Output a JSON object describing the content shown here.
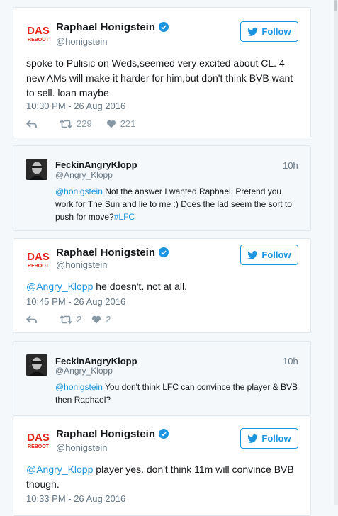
{
  "tweet1": {
    "name": "Raphael Honigstein",
    "handle": "@honigstein",
    "follow_label": "Follow",
    "text": "spoke to Pulisic on Weds,seemed very excited about CL. 4 new AMs will make it harder for him,but don't think BVB want to sell. loan maybe",
    "timestamp": "10:30 PM - 26 Aug 2016",
    "retweets": "229",
    "likes": "221"
  },
  "reply1": {
    "name": "FeckinAngryKlopp",
    "handle": "@Angry_Klopp",
    "time": "10h",
    "mention": "@honigstein",
    "text": " Not the answer I wanted Raphael. Pretend you work for The Sun and lie to me :) Does the lad seem the sort to push for move?",
    "hashtag": "#LFC"
  },
  "tweet2": {
    "name": "Raphael Honigstein",
    "handle": "@honigstein",
    "follow_label": "Follow",
    "mention": "@Angry_Klopp",
    "text": " he doesn't. not at all.",
    "timestamp": "10:45 PM - 26 Aug 2016",
    "retweets": "2",
    "likes": "2"
  },
  "reply2": {
    "name": "FeckinAngryKlopp",
    "handle": "@Angry_Klopp",
    "time": "10h",
    "mention": "@honigstein",
    "text": " You don't think LFC can convince the player & BVB then Raphael?"
  },
  "tweet3": {
    "name": "Raphael Honigstein",
    "handle": "@honigstein",
    "follow_label": "Follow",
    "mention": "@Angry_Klopp",
    "text": " player yes. don't think 11m will convince BVB though.",
    "timestamp": "10:33 PM - 26 Aug 2016"
  },
  "avatar_logo": {
    "line1": "DAS",
    "line2": "REBOOT"
  },
  "colors": {
    "accent": "#1b95e0",
    "avatar_red": "#e2231a",
    "text_secondary": "#657786",
    "card_border": "#e1e8ed"
  },
  "icons": [
    "twitter-bird-icon",
    "verified-badge-icon",
    "reply-icon",
    "retweet-icon",
    "like-icon"
  ]
}
